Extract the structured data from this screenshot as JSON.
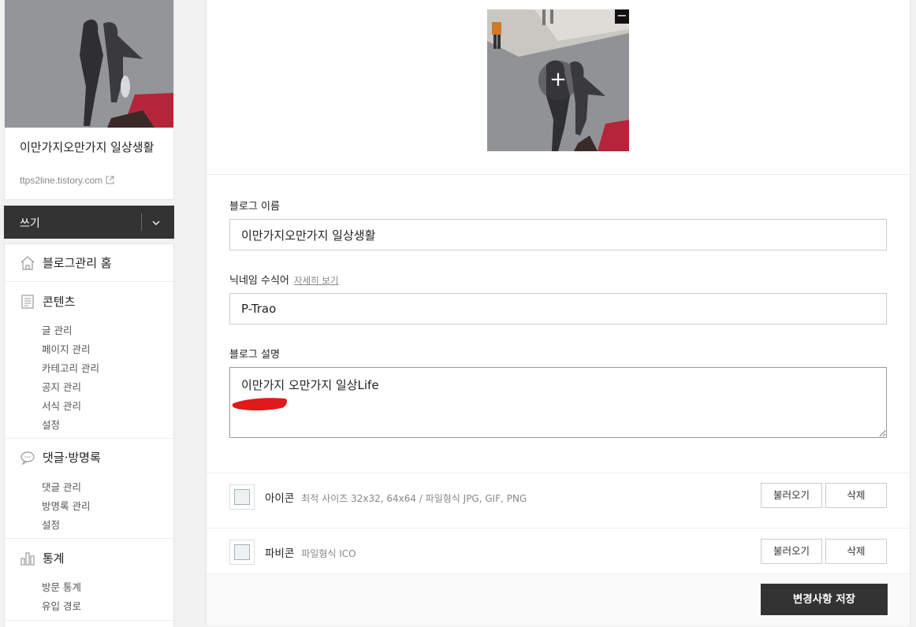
{
  "sidebar": {
    "blog_title": "이만가지오만가지 일상생활",
    "blog_url": "ttps2line.tistory.com",
    "write_label": "쓰기",
    "menu": {
      "home": "블로그관리 홈",
      "contents": {
        "title": "콘텐츠",
        "items": [
          "글 관리",
          "페이지 관리",
          "카테고리 관리",
          "공지 관리",
          "서식 관리",
          "설정"
        ]
      },
      "comments": {
        "title": "댓글·방명록",
        "items": [
          "댓글 관리",
          "방명록 관리",
          "설정"
        ]
      },
      "stats": {
        "title": "통계",
        "items": [
          "방문 통계",
          "유입 경로"
        ]
      }
    }
  },
  "form": {
    "blog_name_label": "블로그 이름",
    "blog_name_value": "이만가지오만가지 일상생활",
    "nickname_label": "닉네임 수식어",
    "nickname_link": "자세히 보기",
    "nickname_value": "P-Trao",
    "desc_label": "블로그 설명",
    "desc_value": "이만가지 오만가지 일상Life"
  },
  "icon_row": {
    "name": "아이콘",
    "desc": "최적 사이즈 32x32, 64x64 / 파일형식 JPG, GIF, PNG",
    "load": "불러오기",
    "delete": "삭제"
  },
  "favicon_row": {
    "name": "파비콘",
    "desc": "파일형식 ICO",
    "load": "불러오기",
    "delete": "삭제"
  },
  "cover": {
    "minus": "−",
    "plus": "+"
  },
  "save_label": "변경사항 저장",
  "colors": {
    "dark": "#333333",
    "border": "#cccccc",
    "marker": "#e0191b"
  }
}
